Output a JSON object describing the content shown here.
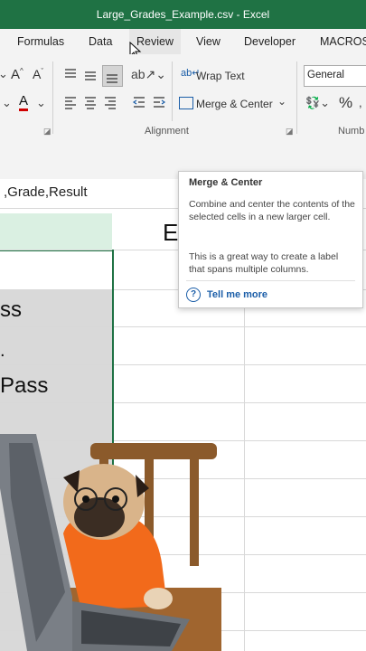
{
  "window": {
    "title": "Large_Grades_Example.csv  -  Excel"
  },
  "menu": {
    "tabs": [
      "Formulas",
      "Data",
      "Review",
      "View",
      "Developer",
      "MACROS"
    ],
    "active": "Review"
  },
  "ribbon": {
    "font_grow": "A",
    "font_shrink": "A",
    "wrap_text": "Wrap Text",
    "merge_center": "Merge & Center",
    "number_format": "General",
    "alignment_group": "Alignment",
    "number_group": "Numb",
    "percent": "%"
  },
  "formula_bar": {
    "value": ",Grade,Result"
  },
  "sheet": {
    "visible_cells": [
      "ss",
      "Pass"
    ],
    "header_letter": "E"
  },
  "tooltip": {
    "title": "Merge & Center",
    "desc": "Combine and center the contents of the selected cells in a new larger cell.",
    "desc2": "This is a great way to create a label that spans multiple columns.",
    "more": "Tell me more"
  },
  "colors": {
    "excel_green": "#1f7244",
    "link_blue": "#1b5ea8"
  }
}
